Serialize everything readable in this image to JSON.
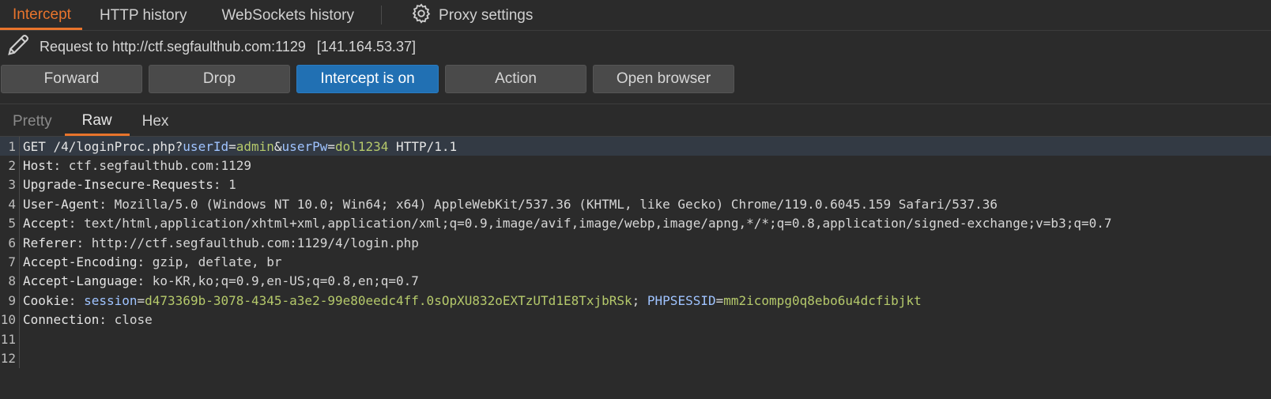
{
  "tabs": [
    "Intercept",
    "HTTP history",
    "WebSockets history"
  ],
  "settings_label": "Proxy settings",
  "request": {
    "label": "Request to http://ctf.segfaulthub.com:1129",
    "ip": "[141.164.53.37]"
  },
  "buttons": {
    "forward": "Forward",
    "drop": "Drop",
    "intercept": "Intercept is on",
    "action": "Action",
    "open_browser": "Open browser"
  },
  "view_tabs": [
    "Pretty",
    "Raw",
    "Hex"
  ],
  "colors": {
    "accent": "#e8742c",
    "intercept_on": "#2170b3",
    "param_name": "#9fc3ff",
    "param_value": "#b5c96b"
  },
  "lines": {
    "n": [
      "1",
      "2",
      "3",
      "4",
      "5",
      "6",
      "7",
      "8",
      "9",
      "10",
      "11",
      "12"
    ],
    "l1": {
      "method_path": "GET /4/loginProc.php?",
      "p1k": "userId",
      "eq1": "=",
      "p1v": "admin",
      "amp": "&",
      "p2k": "userPw",
      "eq2": "=",
      "p2v": "dol1234",
      "proto": " HTTP/1.1"
    },
    "l2": {
      "name": "Host",
      "value": ": ctf.segfaulthub.com:1129"
    },
    "l3": {
      "name": "Upgrade-Insecure-Requests",
      "value": ": 1"
    },
    "l4": {
      "name": "User-Agent",
      "value": ": Mozilla/5.0 (Windows NT 10.0; Win64; x64) AppleWebKit/537.36 (KHTML, like Gecko) Chrome/119.0.6045.159 Safari/537.36"
    },
    "l5": {
      "name": "Accept",
      "value": ": text/html,application/xhtml+xml,application/xml;q=0.9,image/avif,image/webp,image/apng,*/*;q=0.8,application/signed-exchange;v=b3;q=0.7"
    },
    "l6": {
      "name": "Referer",
      "value": ": http://ctf.segfaulthub.com:1129/4/login.php"
    },
    "l7": {
      "name": "Accept-Encoding",
      "value": ": gzip, deflate, br"
    },
    "l8": {
      "name": "Accept-Language",
      "value": ": ko-KR,ko;q=0.9,en-US;q=0.8,en;q=0.7"
    },
    "l9": {
      "name": "Cookie",
      "sep": ": ",
      "c1k": "session",
      "eq1": "=",
      "c1v": "d473369b-3078-4345-a3e2-99e80eedc4ff.0sOpXU832oEXTzUTd1E8TxjbRSk",
      "semi": "; ",
      "c2k": "PHPSESSID",
      "eq2": "=",
      "c2v": "mm2icompg0q8ebo6u4dcfibjkt"
    },
    "l10": {
      "name": "Connection",
      "value": ": close"
    }
  }
}
